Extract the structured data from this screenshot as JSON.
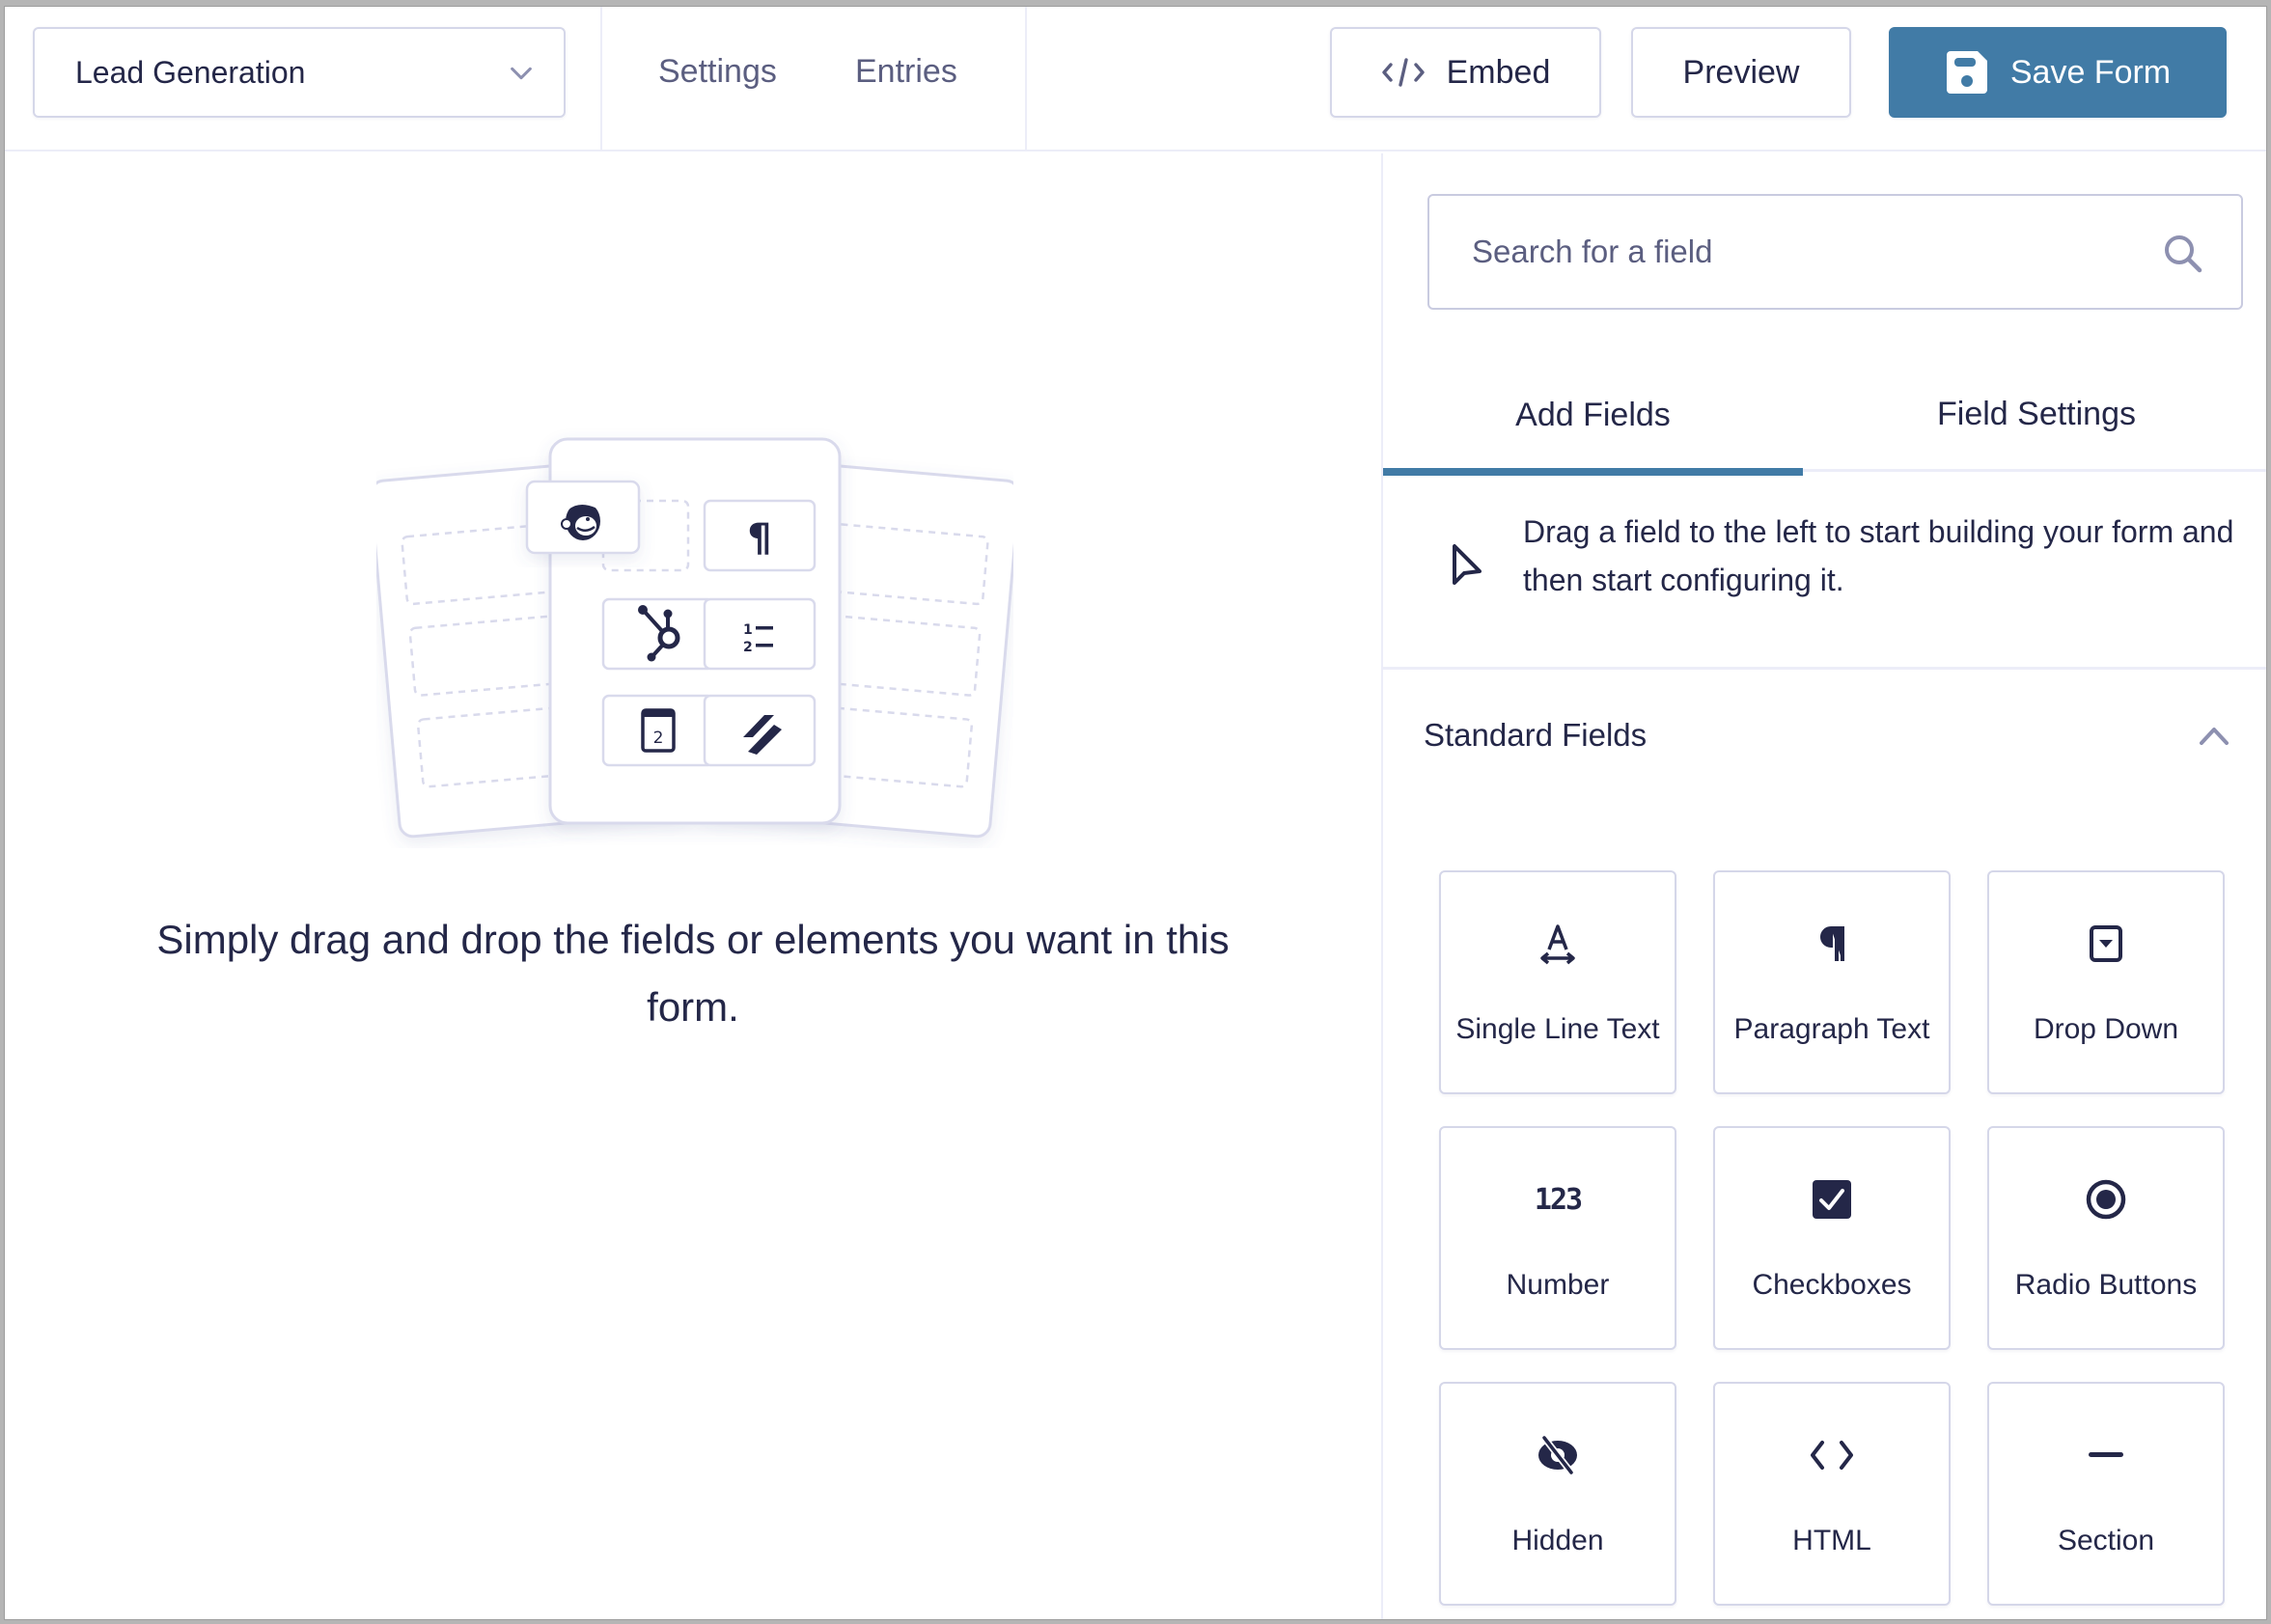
{
  "topbar": {
    "form_selector": {
      "value": "Lead Generation",
      "icon": "chevron-down-icon"
    },
    "nav": [
      {
        "label": "Settings"
      },
      {
        "label": "Entries"
      }
    ],
    "embed_label": "Embed",
    "preview_label": "Preview",
    "save_label": "Save Form"
  },
  "canvas": {
    "empty_message": "Simply drag and drop the fields or elements you want in this form.",
    "illustration_icons": [
      "mailchimp-icon",
      "paragraph-icon",
      "hubspot-icon",
      "numbered-list-icon",
      "calendar-icon",
      "slash-logo-icon"
    ],
    "calendar_day": "2",
    "list_numbers": [
      "1",
      "2"
    ]
  },
  "panel": {
    "search_placeholder": "Search for a field",
    "tabs": [
      {
        "label": "Add Fields",
        "active": true
      },
      {
        "label": "Field Settings",
        "active": false
      }
    ],
    "hint": "Drag a field to the left to start building your form and then start configuring it.",
    "section_title": "Standard Fields",
    "section_expanded": true,
    "fields": [
      {
        "label": "Single Line Text",
        "icon": "text-width-icon"
      },
      {
        "label": "Paragraph Text",
        "icon": "paragraph-icon"
      },
      {
        "label": "Drop Down",
        "icon": "dropdown-icon"
      },
      {
        "label": "Number",
        "icon": "number-icon",
        "glyph": "123"
      },
      {
        "label": "Checkboxes",
        "icon": "checkbox-icon"
      },
      {
        "label": "Radio Buttons",
        "icon": "radio-icon"
      },
      {
        "label": "Hidden",
        "icon": "eye-slash-icon"
      },
      {
        "label": "HTML",
        "icon": "code-icon"
      },
      {
        "label": "Section",
        "icon": "minus-icon"
      }
    ]
  },
  "colors": {
    "accent": "#417ba6",
    "text": "#242748",
    "muted": "#5b5e80",
    "border": "#d5d7e9",
    "divider": "#ecedf8"
  }
}
